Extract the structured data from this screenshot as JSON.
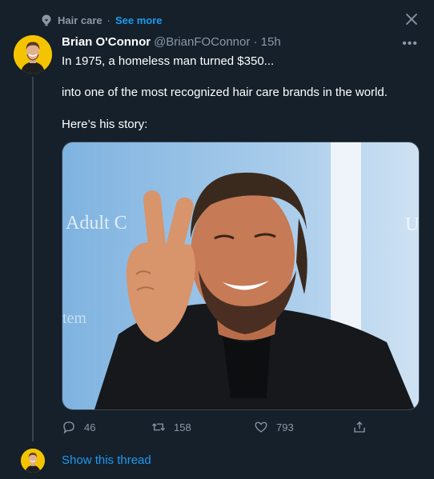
{
  "topic": {
    "label": "Hair care",
    "separator": "·",
    "see_more": "See more"
  },
  "tweet": {
    "author_name": "Brian O'Connor",
    "handle_time": "@BrianFOConnor · 15h",
    "lines": [
      "In 1975, a homeless man turned $350...",
      "into one of the most recognized hair care brands in the world.",
      "Here’s his story:"
    ],
    "media_sign_text": [
      "Adult C",
      "tem",
      "U"
    ],
    "stats": {
      "replies": "46",
      "retweets": "158",
      "likes": "793"
    }
  },
  "show_thread_label": "Show this thread",
  "colors": {
    "background": "#15202b",
    "accent": "#1d9bf0",
    "muted": "#8b98a5"
  },
  "icons": [
    "topic-icon",
    "close-icon",
    "more-icon",
    "reply-icon",
    "retweet-icon",
    "like-icon",
    "share-icon"
  ]
}
